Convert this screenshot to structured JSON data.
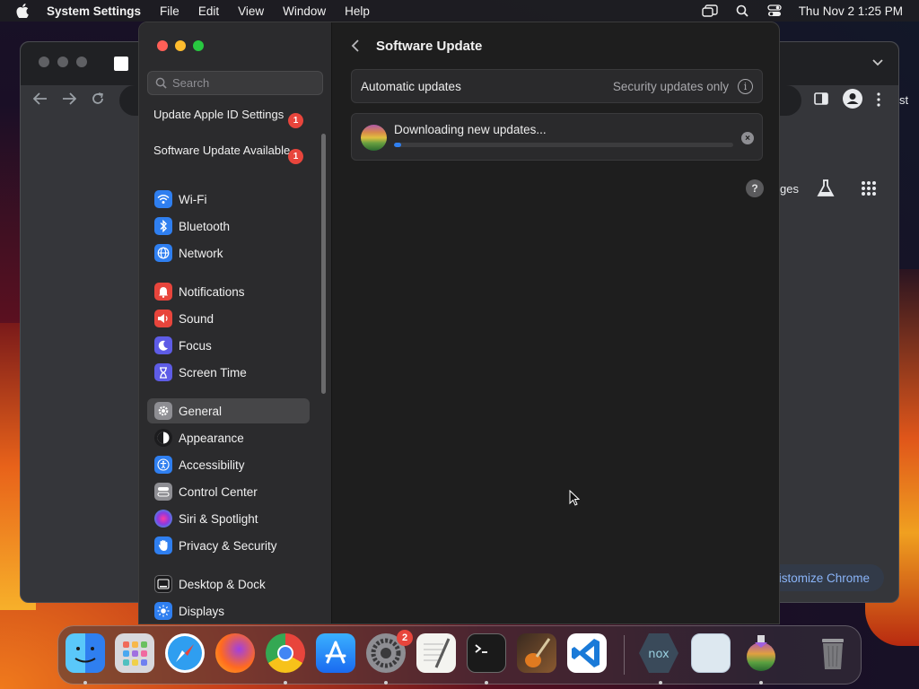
{
  "menubar": {
    "app_name": "System Settings",
    "menus": [
      "File",
      "Edit",
      "View",
      "Window",
      "Help"
    ],
    "datetime": "Thu Nov 2  1:25 PM"
  },
  "chrome": {
    "partial_text_right": "st",
    "partial_text_ges": "ges",
    "customize_label": "istomize Chrome"
  },
  "settings": {
    "search_placeholder": "Search",
    "notices": [
      {
        "label": "Update Apple ID Settings",
        "badge": "1"
      },
      {
        "label": "Software Update Available",
        "badge": "1"
      }
    ],
    "nav": [
      {
        "label": "Wi-Fi",
        "icon": "wifi-icon",
        "color": "#2f7ff0"
      },
      {
        "label": "Bluetooth",
        "icon": "bluetooth-icon",
        "color": "#2f7ff0"
      },
      {
        "label": "Network",
        "icon": "globe-icon",
        "color": "#2f7ff0"
      },
      {
        "label": "Notifications",
        "icon": "bell-icon",
        "color": "#e8453c"
      },
      {
        "label": "Sound",
        "icon": "speaker-icon",
        "color": "#e8453c"
      },
      {
        "label": "Focus",
        "icon": "moon-icon",
        "color": "#5e5ce6"
      },
      {
        "label": "Screen Time",
        "icon": "hourglass-icon",
        "color": "#5e5ce6"
      },
      {
        "label": "General",
        "icon": "gear-icon",
        "color": "#8e8e93"
      },
      {
        "label": "Appearance",
        "icon": "appearance-icon",
        "color": "#1c1c1e"
      },
      {
        "label": "Accessibility",
        "icon": "accessibility-icon",
        "color": "#2f7ff0"
      },
      {
        "label": "Control Center",
        "icon": "control-center-icon",
        "color": "#8e8e93"
      },
      {
        "label": "Siri & Spotlight",
        "icon": "siri-icon",
        "color": "#b03ad0"
      },
      {
        "label": "Privacy & Security",
        "icon": "hand-icon",
        "color": "#2f7ff0"
      },
      {
        "label": "Desktop & Dock",
        "icon": "dock-icon",
        "color": "#1c1c1e"
      },
      {
        "label": "Displays",
        "icon": "sun-icon",
        "color": "#2f7ff0"
      }
    ],
    "active_nav": "General",
    "page_title": "Software Update",
    "auto_updates_label": "Automatic updates",
    "auto_updates_value": "Security updates only",
    "download_status": "Downloading new updates...",
    "download_progress": 0.02,
    "help_label": "?"
  },
  "dock": {
    "apps": [
      "Finder",
      "Launchpad",
      "Safari",
      "Firefox",
      "Google Chrome",
      "App Store",
      "System Settings",
      "TextEdit",
      "Terminal",
      "GarageBand",
      "Visual Studio Code",
      "Nox",
      "Preview",
      "macOS Installer",
      "Trash"
    ],
    "system_settings_badge": "2"
  }
}
